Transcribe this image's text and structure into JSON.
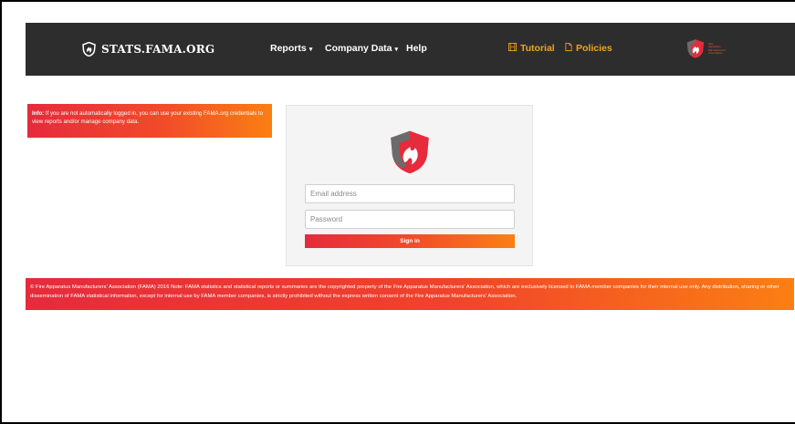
{
  "brand": {
    "name": "STATS.FAMA.ORG",
    "logo_icon": "fama-shield-icon"
  },
  "nav": {
    "reports": "Reports",
    "company_data": "Company Data",
    "help": "Help",
    "tutorial": "Tutorial",
    "policies": "Policies",
    "caret": "▾",
    "tutorial_icon": "film-icon",
    "policies_icon": "document-icon",
    "association_logo_lines": [
      "Fire",
      "Apparatus",
      "Manufacturers'",
      "Association"
    ]
  },
  "info": {
    "label": "Info:",
    "text": " If you are not automatically logged in, you can use your existing FAMA.org credentials to view reports and/or manage company data."
  },
  "login": {
    "email_placeholder": "Email address",
    "password_placeholder": "Password",
    "signin_label": "Sign in"
  },
  "footer": {
    "text": "© Fire Apparatus Manufacturers' Association (FAMA) 2016 Note: FAMA statistics and statistical reports or summaries are the copyrighted property of the Fire Apparatus Manufacturers' Association, which are exclusively licensed to FAMA member companies for their internal use only. Any distribution, sharing or other dissemination of FAMA statistical information, except for internal use by FAMA member companies, is strictly prohibited without the express written consent of the Fire Apparatus Manufacturers' Association."
  },
  "colors": {
    "navbar": "#2d2d2d",
    "accent_orange": "#f5a41b",
    "gradient_red": "#e52b3c",
    "gradient_orange": "#fb7f12"
  }
}
